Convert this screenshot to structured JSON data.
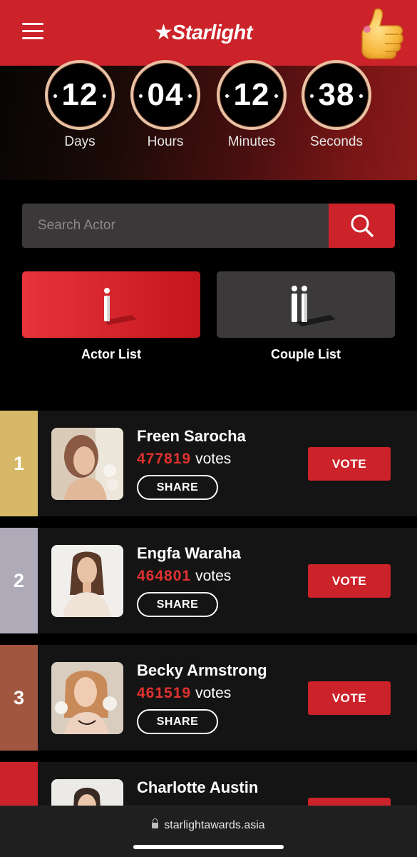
{
  "header": {
    "logo_text": "Starlight",
    "menu_icon": "hamburger-menu-icon",
    "sticker_icon": "thumbs-up-icon"
  },
  "countdown": [
    {
      "value": "12",
      "label": "Days"
    },
    {
      "value": "04",
      "label": "Hours"
    },
    {
      "value": "12",
      "label": "Minutes"
    },
    {
      "value": "38",
      "label": "Seconds"
    }
  ],
  "search": {
    "placeholder": "Search Actor",
    "icon": "search-icon"
  },
  "lists": {
    "actor_label": "Actor List",
    "couple_label": "Couple List"
  },
  "ranking": [
    {
      "rank": "1",
      "name": "Freen Sarocha",
      "votes": "477819",
      "votes_suffix": "votes",
      "share": "SHARE",
      "vote": "VOTE",
      "rank_color": "#d6b866"
    },
    {
      "rank": "2",
      "name": "Engfa Waraha",
      "votes": "464801",
      "votes_suffix": "votes",
      "share": "SHARE",
      "vote": "VOTE",
      "rank_color": "#aeaab8"
    },
    {
      "rank": "3",
      "name": "Becky Armstrong",
      "votes": "461519",
      "votes_suffix": "votes",
      "share": "SHARE",
      "vote": "VOTE",
      "rank_color": "#a1573f"
    },
    {
      "rank": "",
      "name": "Charlotte Austin",
      "votes": "",
      "votes_suffix": "",
      "share": "",
      "vote": "",
      "rank_color": "#cc2229"
    }
  ],
  "browser": {
    "url": "starlightawards.asia"
  },
  "colors": {
    "brand_red": "#cc2229",
    "vote_count": "#e0322f",
    "card_bg": "#141414"
  }
}
